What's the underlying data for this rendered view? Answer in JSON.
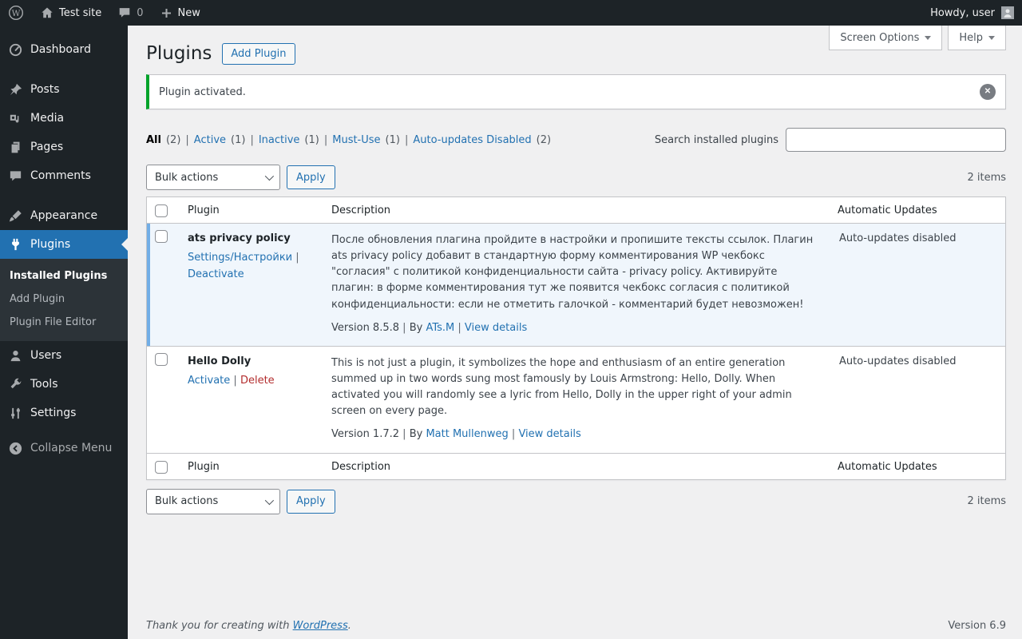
{
  "ui": {
    "sep": "|"
  },
  "colors": {
    "accent": "#2271b1",
    "success_notice": "#00a32a",
    "danger": "#b32d2e",
    "active_row_bg": "#f0f6fc",
    "active_row_border": "#72aee6",
    "admin_dark": "#1d2327"
  },
  "admin_bar": {
    "site_name": "Test site",
    "comment_count": "0",
    "new_label": "New",
    "greeting": "Howdy, user"
  },
  "sidebar": {
    "items": [
      {
        "label": "Dashboard"
      },
      {
        "label": "Posts"
      },
      {
        "label": "Media"
      },
      {
        "label": "Pages"
      },
      {
        "label": "Comments"
      },
      {
        "label": "Appearance"
      },
      {
        "label": "Plugins"
      },
      {
        "label": "Users"
      },
      {
        "label": "Tools"
      },
      {
        "label": "Settings"
      }
    ],
    "submenu": {
      "items": [
        {
          "label": "Installed Plugins"
        },
        {
          "label": "Add Plugin"
        },
        {
          "label": "Plugin File Editor"
        }
      ]
    },
    "collapse_label": "Collapse Menu"
  },
  "screen_tabs": {
    "screen_options": "Screen Options",
    "help": "Help"
  },
  "page": {
    "title": "Plugins",
    "add_plugin_label": "Add Plugin"
  },
  "notice": {
    "message": "Plugin activated."
  },
  "filters": {
    "items": [
      {
        "label": "All",
        "count": "(2)"
      },
      {
        "label": "Active",
        "count": "(1)"
      },
      {
        "label": "Inactive",
        "count": "(1)"
      },
      {
        "label": "Must-Use",
        "count": "(1)"
      },
      {
        "label": "Auto-updates Disabled",
        "count": "(2)"
      }
    ]
  },
  "search": {
    "label": "Search installed plugins",
    "value": ""
  },
  "bulk": {
    "select_value": "Bulk actions",
    "apply_label": "Apply",
    "items_count": "2 items"
  },
  "table": {
    "headers": {
      "plugin": "Plugin",
      "description": "Description",
      "auto_updates": "Automatic Updates"
    },
    "rows": [
      {
        "name": "ats privacy policy",
        "actions": [
          {
            "label": "Settings/Настройки"
          },
          {
            "label": "Deactivate"
          }
        ],
        "description": "После обновления плагина пройдите в настройки и пропишите тексты ссылок. Плагин ats privacy policy добавит в стандартную форму комментирования WP чекбокс \"согласия\" с политикой конфиденциальности сайта - privacy policy. Активируйте плагин: в форме комментирования тут же появится чекбокс согласия с политикой конфиденциальности: если не отметить галочкой - комментарий будет невозможен!",
        "version": "Version 8.5.8",
        "by_label": "By",
        "author": "ATs.M",
        "view_details": "View details",
        "auto_update_status": "Auto-updates disabled"
      },
      {
        "name": "Hello Dolly",
        "actions": [
          {
            "label": "Activate"
          },
          {
            "label": "Delete"
          }
        ],
        "description": "This is not just a plugin, it symbolizes the hope and enthusiasm of an entire generation summed up in two words sung most famously by Louis Armstrong: Hello, Dolly. When activated you will randomly see a lyric from Hello, Dolly in the upper right of your admin screen on every page.",
        "version": "Version 1.7.2",
        "by_label": "By",
        "author": "Matt Mullenweg",
        "view_details": "View details",
        "auto_update_status": "Auto-updates disabled"
      }
    ]
  },
  "footer": {
    "thankyou_prefix": "Thank you for creating with ",
    "wordpress_link": "WordPress",
    "thankyou_suffix": ".",
    "version": "Version 6.9"
  }
}
